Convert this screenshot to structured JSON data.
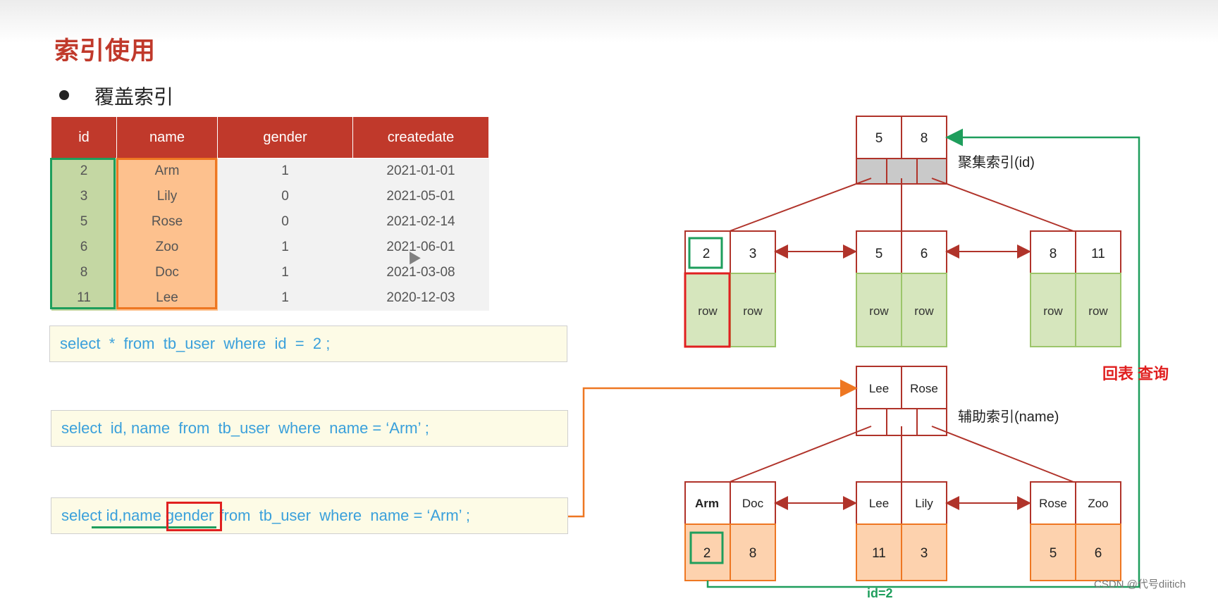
{
  "title": "索引使用",
  "bullet": "覆盖索引",
  "table": {
    "headers": [
      "id",
      "name",
      "gender",
      "createdate"
    ],
    "rows": [
      [
        "2",
        "Arm",
        "1",
        "2021-01-01"
      ],
      [
        "3",
        "Lily",
        "0",
        "2021-05-01"
      ],
      [
        "5",
        "Rose",
        "0",
        "2021-02-14"
      ],
      [
        "6",
        "Zoo",
        "1",
        "2021-06-01"
      ],
      [
        "8",
        "Doc",
        "1",
        "2021-03-08"
      ],
      [
        "11",
        "Lee",
        "1",
        "2020-12-03"
      ]
    ]
  },
  "queries": {
    "q1": "select  *  from  tb_user  where  id  =  2 ;",
    "q2": "select  id, name  from  tb_user  where  name = ‘Arm’ ;",
    "q3_a": "select ",
    "q3_b": "id,name",
    "q3_c": "gender",
    "q3_d": "from  tb_user  where  name = ‘Arm’ ;"
  },
  "clustered": {
    "label": "聚集索引(id)",
    "root": [
      "5",
      "8"
    ],
    "leaves": [
      {
        "keys": [
          "2",
          "3"
        ],
        "rows": [
          "row",
          "row"
        ]
      },
      {
        "keys": [
          "5",
          "6"
        ],
        "rows": [
          "row",
          "row"
        ]
      },
      {
        "keys": [
          "8",
          "11"
        ],
        "rows": [
          "row",
          "row"
        ]
      }
    ]
  },
  "secondary": {
    "label": "辅助索引(name)",
    "root": [
      "Lee",
      "Rose"
    ],
    "leaves": [
      {
        "keys": [
          "Arm",
          "Doc"
        ],
        "ids": [
          "2",
          "8"
        ]
      },
      {
        "keys": [
          "Lee",
          "Lily"
        ],
        "ids": [
          "11",
          "3"
        ]
      },
      {
        "keys": [
          "Rose",
          "Zoo"
        ],
        "ids": [
          "5",
          "6"
        ]
      }
    ]
  },
  "back_lookup_label": "回表 查询",
  "bottom_label": "id=2",
  "watermark": "CSDN @代号diitich",
  "colors": {
    "accent_red": "#c0392b",
    "green": "#1e9e5c",
    "orange": "#ee7722",
    "green_fill": "#d6e6bd",
    "orange_fill": "#fdd2ae",
    "sql_text": "#3aa0db"
  }
}
